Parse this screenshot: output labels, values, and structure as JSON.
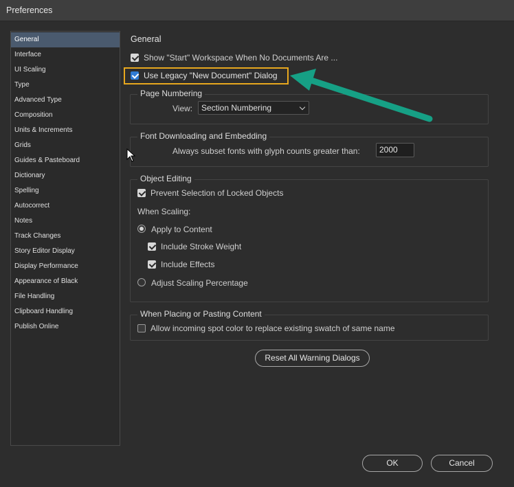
{
  "window": {
    "title": "Preferences"
  },
  "sidebar": {
    "items": [
      "General",
      "Interface",
      "UI Scaling",
      "Type",
      "Advanced Type",
      "Composition",
      "Units & Increments",
      "Grids",
      "Guides & Pasteboard",
      "Dictionary",
      "Spelling",
      "Autocorrect",
      "Notes",
      "Track Changes",
      "Story Editor Display",
      "Display Performance",
      "Appearance of Black",
      "File Handling",
      "Clipboard Handling",
      "Publish Online"
    ],
    "selected": "General"
  },
  "general": {
    "heading": "General",
    "show_start_label": "Show \"Start\" Workspace When No Documents Are ...",
    "use_legacy_label": "Use Legacy \"New Document\" Dialog"
  },
  "page_numbering": {
    "title": "Page Numbering",
    "view_label": "View:",
    "view_value": "Section Numbering"
  },
  "font_downloading": {
    "title": "Font Downloading and Embedding",
    "subset_label": "Always subset fonts with glyph counts greater than:",
    "subset_value": "2000"
  },
  "object_editing": {
    "title": "Object Editing",
    "prevent_selection_label": "Prevent Selection of Locked Objects",
    "when_scaling_label": "When Scaling:",
    "apply_to_content_label": "Apply to Content",
    "include_stroke_label": "Include Stroke Weight",
    "include_effects_label": "Include Effects",
    "adjust_scaling_label": "Adjust Scaling Percentage"
  },
  "placing": {
    "title": "When Placing or Pasting Content",
    "allow_spot_label": "Allow incoming spot color to replace existing swatch of same name"
  },
  "buttons": {
    "reset_warnings": "Reset All Warning Dialogs",
    "ok": "OK",
    "cancel": "Cancel"
  },
  "colors": {
    "highlight": "#e8a81e",
    "arrow": "#16a085",
    "selected_item": "#4a5a6e",
    "checkbox_accent": "#2f7bd4"
  }
}
